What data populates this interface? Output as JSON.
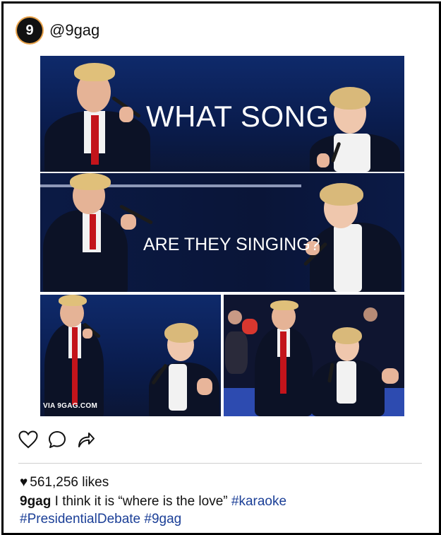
{
  "post": {
    "username": "@9gag",
    "avatar_glyph": "9",
    "image": {
      "line1": "WHAT SONG",
      "line2": "ARE THEY SINGING?",
      "watermark": "VIA 9GAG.COM"
    },
    "icons": [
      "heart-outline-icon",
      "comment-icon",
      "share-icon"
    ],
    "likes_text": "561,256 likes",
    "caption": {
      "user": "9gag",
      "text": "I think it is “where is the love”",
      "hashtags": [
        "#karaoke",
        "#PresidentialDebate",
        "#9gag"
      ]
    }
  },
  "colors": {
    "hashtag": "#1b3f97",
    "avatar_ring": "#e8a24a",
    "tie": "#c3141b",
    "stage_blue": "#0f2a6b"
  }
}
